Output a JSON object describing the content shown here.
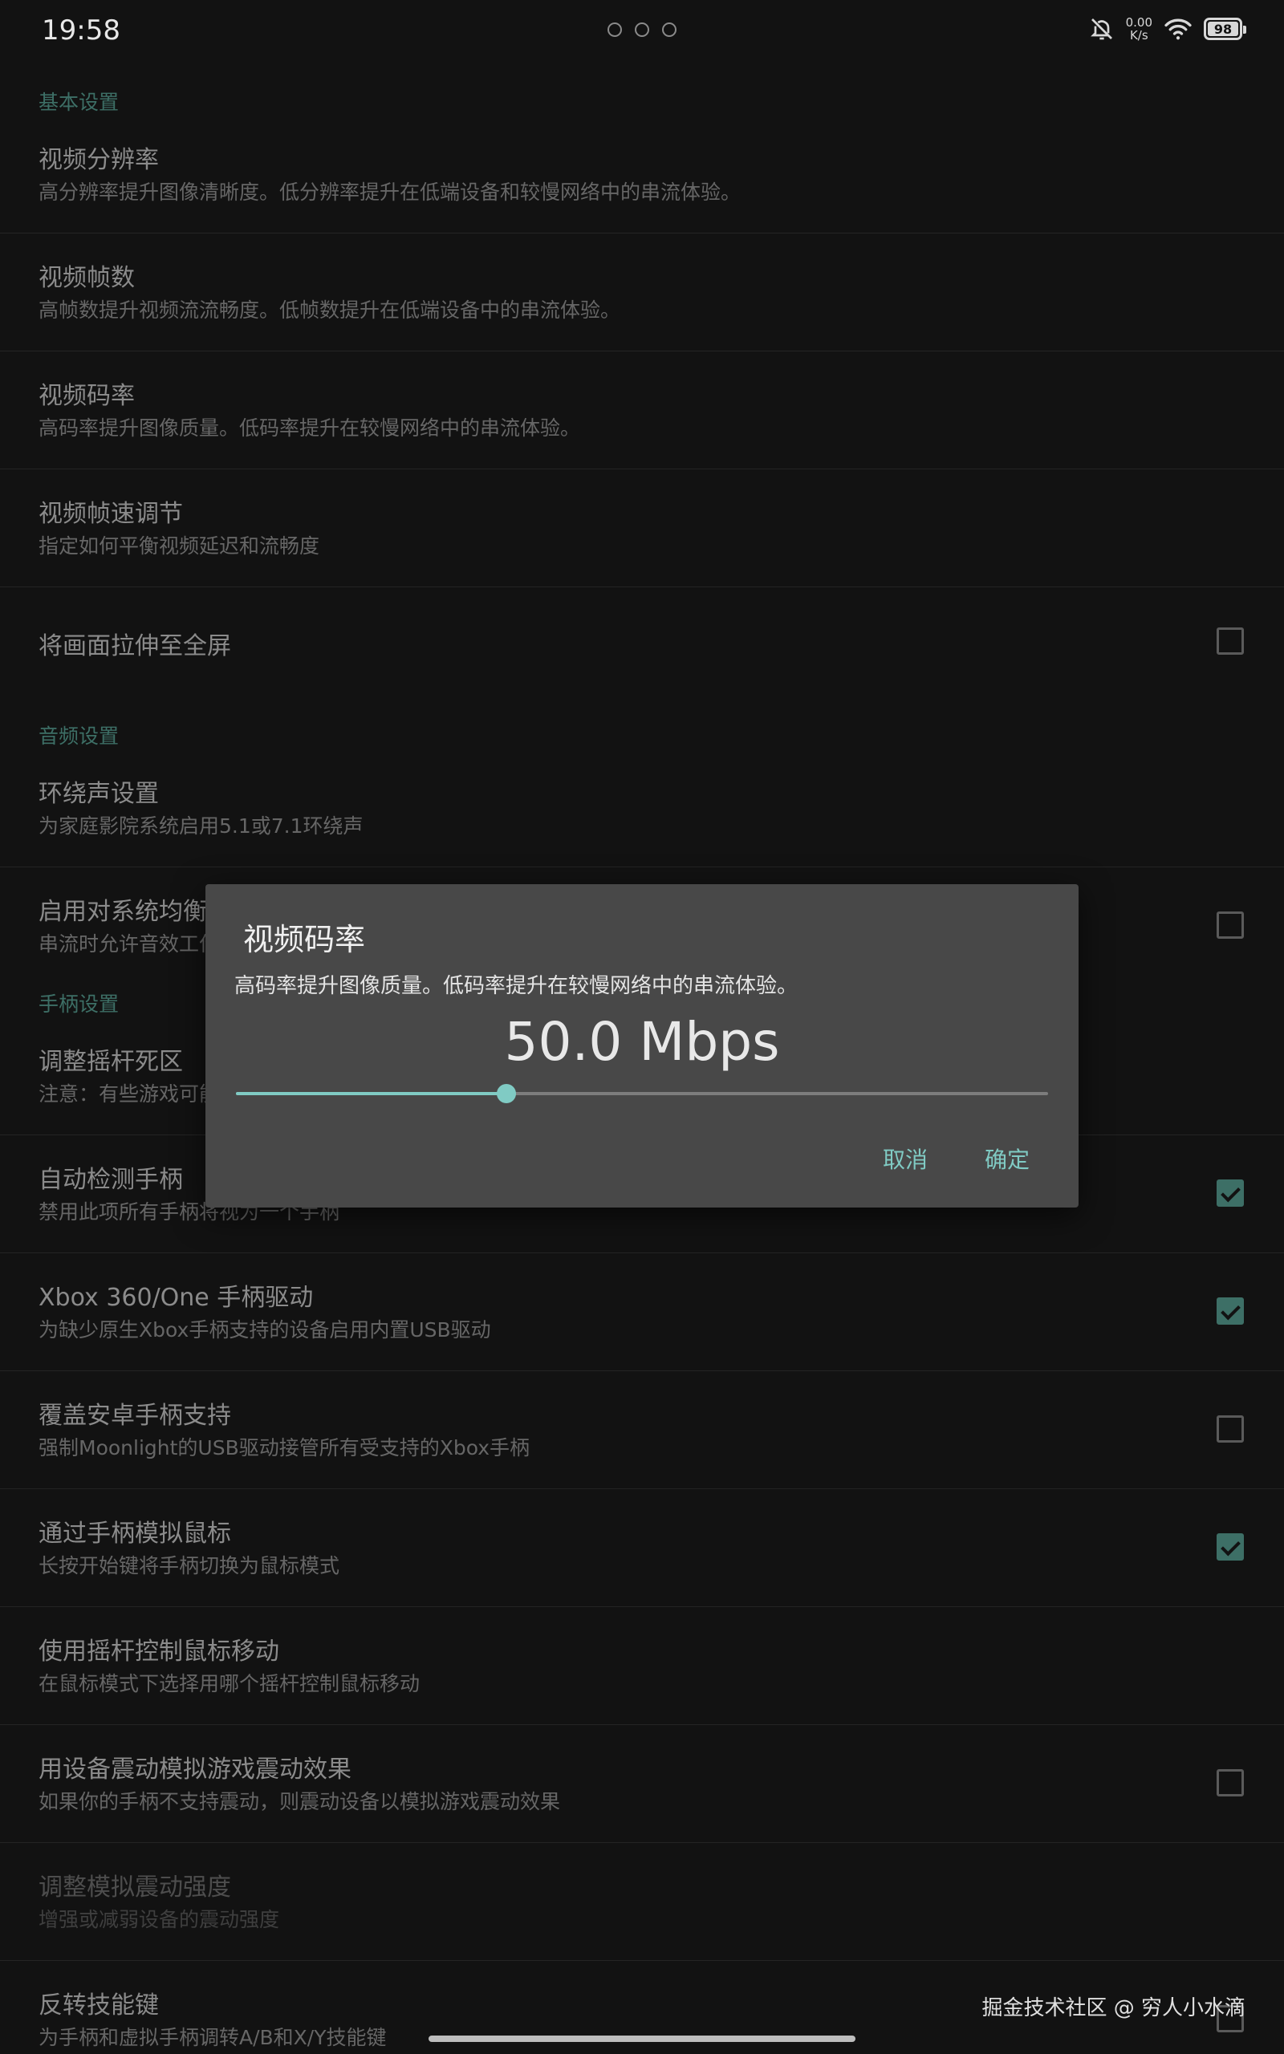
{
  "status_bar": {
    "time": "19:58",
    "speed_value": "0.00",
    "speed_unit": "K/s",
    "battery": "98"
  },
  "colors": {
    "accent": "#80cbc4",
    "section_header": "#3d6f66",
    "background": "#121212",
    "dialog_background": "#484848"
  },
  "sections": {
    "basic": {
      "header": "基本设置",
      "items": [
        {
          "title": "视频分辨率",
          "summary": "高分辨率提升图像清晰度。低分辨率提升在低端设备和较慢网络中的串流体验。"
        },
        {
          "title": "视频帧数",
          "summary": "高帧数提升视频流流畅度。低帧数提升在低端设备中的串流体验。"
        },
        {
          "title": "视频码率",
          "summary": "高码率提升图像质量。低码率提升在较慢网络中的串流体验。"
        },
        {
          "title": "视频帧速调节",
          "summary": "指定如何平衡视频延迟和流畅度"
        },
        {
          "title": "将画面拉伸至全屏",
          "checked": false
        }
      ]
    },
    "audio": {
      "header": "音频设置",
      "items": [
        {
          "title": "环绕声设置",
          "summary": "为家庭影院系统启用5.1或7.1环绕声"
        },
        {
          "title": "启用对系统均衡器的支持",
          "summary": "串流时允许音效工作",
          "checked": false
        }
      ]
    },
    "gamepad": {
      "header": "手柄设置",
      "items": [
        {
          "title": "调整摇杆死区",
          "summary": "注意：有些游戏可能会强制使用更大的死区"
        },
        {
          "title": "自动检测手柄",
          "summary": "禁用此项所有手柄将视为一个手柄",
          "checked": true
        },
        {
          "title": "Xbox 360/One 手柄驱动",
          "summary": "为缺少原生Xbox手柄支持的设备启用内置USB驱动",
          "checked": true
        },
        {
          "title": "覆盖安卓手柄支持",
          "summary": "强制Moonlight的USB驱动接管所有受支持的Xbox手柄",
          "checked": false
        },
        {
          "title": "通过手柄模拟鼠标",
          "summary": "长按开始键将手柄切换为鼠标模式",
          "checked": true
        },
        {
          "title": "使用摇杆控制鼠标移动",
          "summary": "在鼠标模式下选择用哪个摇杆控制鼠标移动"
        },
        {
          "title": "用设备震动模拟游戏震动效果",
          "summary": "如果你的手柄不支持震动，则震动设备以模拟游戏震动效果",
          "checked": false
        },
        {
          "title": "调整模拟震动强度",
          "summary": "增强或减弱设备的震动强度",
          "disabled": true
        },
        {
          "title": "反转技能键",
          "summary": "为手柄和虚拟手柄调转A/B和X/Y技能键",
          "checked": false
        }
      ]
    }
  },
  "dialog": {
    "title": "视频码率",
    "message": "高码率提升图像质量。低码率提升在较慢网络中的串流体验。",
    "value_text": "50.0 Mbps",
    "slider_fraction": 0.333,
    "cancel_label": "取消",
    "ok_label": "确定"
  },
  "watermark": "掘金技术社区 @ 穷人小水滴"
}
